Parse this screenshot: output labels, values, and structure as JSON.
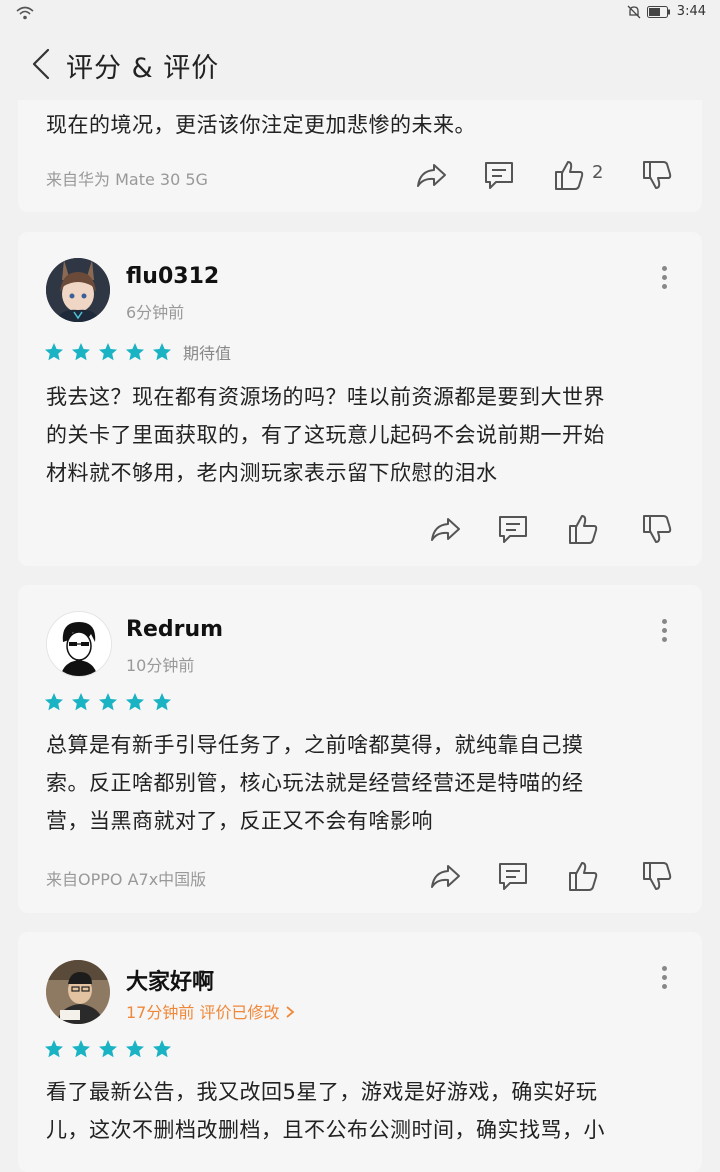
{
  "status_bar": {
    "time": "3:44"
  },
  "header": {
    "title": "评分 & 评价"
  },
  "reviews": [
    {
      "body_lines": [
        "现在的境况，更活该你注定更加悲惨的未来。"
      ],
      "device": "来自华为 Mate 30 5G",
      "likes": "2"
    },
    {
      "username": "flu0312",
      "time": "6分钟前",
      "stars": 5,
      "rating_label": "期待值",
      "body_lines": [
        "我去这？现在都有资源场的吗？哇以前资源都是要到大世界",
        "的关卡了里面获取的，有了这玩意儿起码不会说前期一开始",
        "材料就不够用，老内测玩家表示留下欣慰的泪水"
      ]
    },
    {
      "username": "Redrum",
      "time": "10分钟前",
      "stars": 5,
      "body_lines": [
        "总算是有新手引导任务了，之前啥都莫得，就纯靠自己摸",
        "索。反正啥都别管，核心玩法就是经营经营还是特喵的经",
        "营，当黑商就对了，反正又不会有啥影响"
      ],
      "device": "来自OPPO A7x中国版"
    },
    {
      "username": "大家好啊",
      "time": "17分钟前",
      "edited": "评价已修改",
      "stars": 5,
      "body_lines": [
        "看了最新公告，我又改回5星了，游戏是好游戏，确实好玩",
        "儿，这次不删档改删档，且不公布公测时间，确实找骂，小"
      ]
    }
  ],
  "colors": {
    "star": "#19b3c4",
    "accent_orange": "#f0883a",
    "icon": "#555555"
  }
}
